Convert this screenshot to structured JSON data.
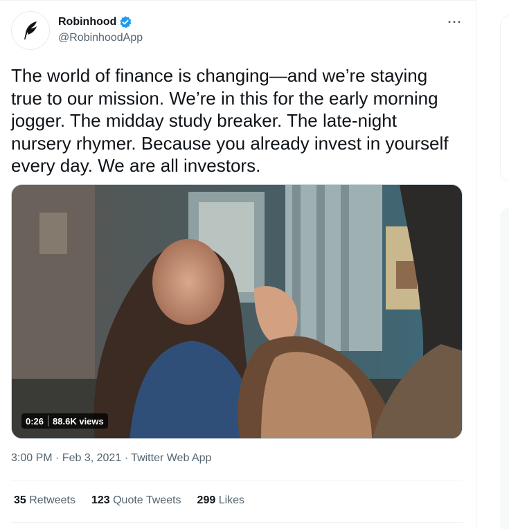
{
  "author": {
    "display_name": "Robinhood",
    "handle": "@RobinhoodApp",
    "verified": true,
    "avatar_icon": "feather-icon"
  },
  "tweet": {
    "text": "The world of finance is changing—and we’re staying\ntrue to our mission. We’re in this for the early morning\njogger. The midday study breaker. The late-night\nnursery rhymer. Because you already invest in yourself\nevery day. We are all investors.",
    "more_label": "···"
  },
  "media": {
    "duration": "0:26",
    "views": "88.6K views"
  },
  "meta": {
    "time": "3:00 PM",
    "date": "Feb 3, 2021",
    "source": "Twitter Web App",
    "separator": "·"
  },
  "stats": [
    {
      "count": "35",
      "label": "Retweets"
    },
    {
      "count": "123",
      "label": "Quote Tweets"
    },
    {
      "count": "299",
      "label": "Likes"
    }
  ],
  "colors": {
    "verified": "#1d9bf0",
    "secondary_text": "#536471",
    "primary_text": "#0f1419"
  }
}
